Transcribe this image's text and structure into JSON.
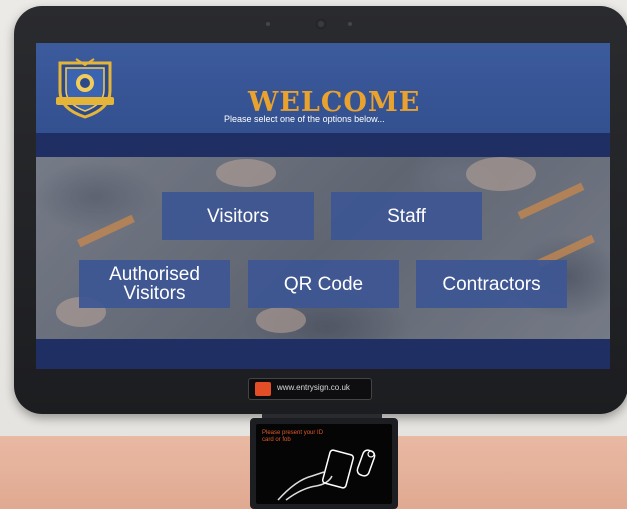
{
  "welcome": {
    "title": "WELCOME",
    "subtitle": "Please select one of the options below..."
  },
  "options": [
    {
      "label": "Visitors"
    },
    {
      "label": "Staff"
    },
    {
      "label": "Authorised Visitors"
    },
    {
      "label": "QR Code"
    },
    {
      "label": "Contractors"
    }
  ],
  "brand": {
    "url": "www.entrysign.co.uk"
  },
  "reader": {
    "instruction": "Please present your ID card or fob"
  },
  "colors": {
    "header": "#3c5b9d",
    "accent": "#e9a22d",
    "button": "#3d5694"
  }
}
